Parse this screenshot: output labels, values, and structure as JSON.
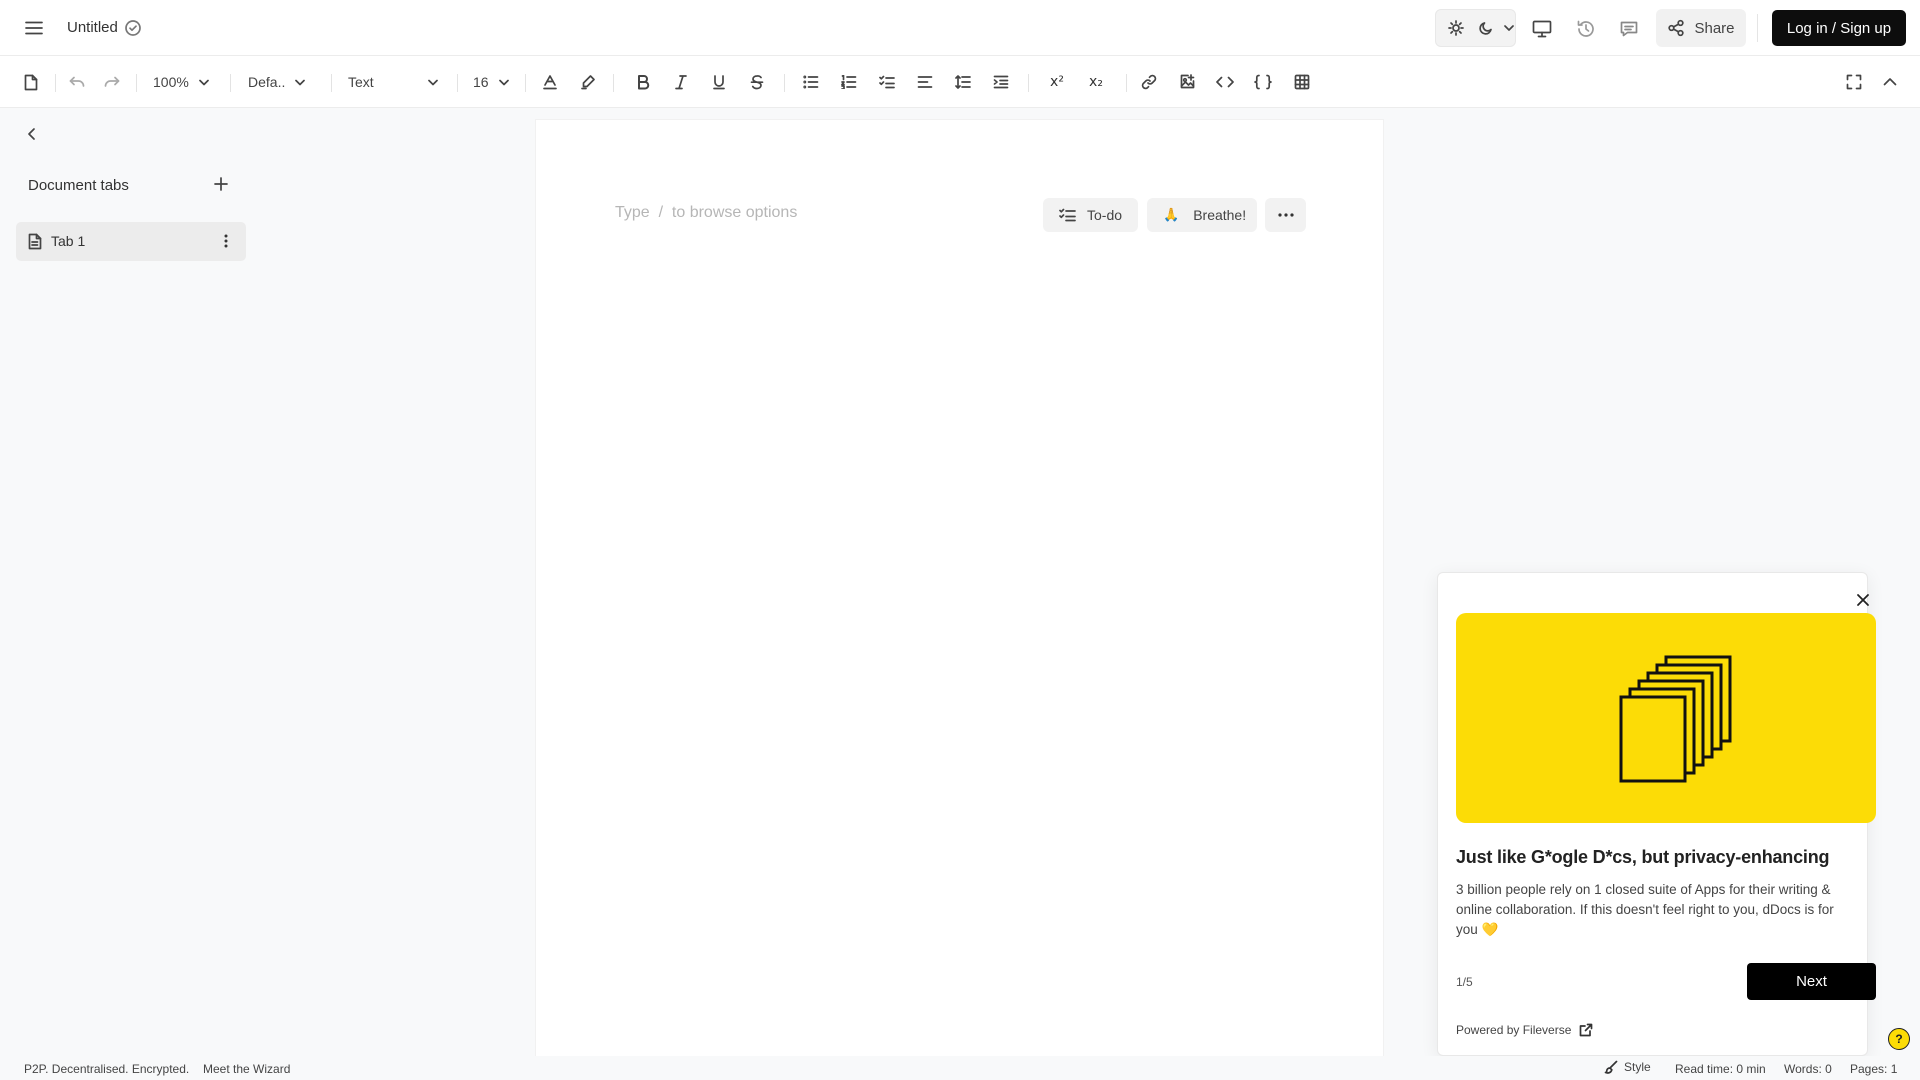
{
  "header": {
    "title": "Untitled",
    "share_label": "Share",
    "login_label": "Log in / Sign up"
  },
  "toolbar": {
    "zoom": "100%",
    "font_family": "Defa..",
    "text_style": "Text",
    "font_size": "16",
    "superscript_glyph": "x²",
    "subscript_glyph": "x₂",
    "icons": [
      "file-icon",
      "undo-icon",
      "redo-icon",
      "text-color-icon",
      "highlighter-icon",
      "bold-icon",
      "italic-icon",
      "underline-icon",
      "strikethrough-icon",
      "bullet-list-icon",
      "numbered-list-icon",
      "checklist-icon",
      "align-left-icon",
      "line-spacing-icon",
      "indent-icon",
      "superscript-icon",
      "subscript-icon",
      "link-icon",
      "image-icon",
      "code-icon",
      "code-block-icon",
      "table-icon",
      "fullscreen-icon",
      "collapse-icon"
    ]
  },
  "sidebar": {
    "heading": "Document tabs",
    "tabs": [
      {
        "label": "Tab 1"
      }
    ]
  },
  "editor": {
    "placeholder": "Type  /  to browse options",
    "quick_actions": [
      {
        "label": "To-do",
        "icon": "checklist-icon"
      },
      {
        "label": "Breathe!",
        "icon": "🙏"
      }
    ]
  },
  "onboarding": {
    "title": "Just like G*ogle D*cs, but privacy-enhancing",
    "body": "3 billion people rely on 1 closed suite of Apps for their writing & online collaboration. If this doesn't feel right to you, dDocs is for you 💛",
    "step": "1/5",
    "next_label": "Next",
    "powered_by": "Powered by Fileverse",
    "hero_color": "#fcdc06"
  },
  "statusbar": {
    "tagline": "P2P. Decentralised. Encrypted.",
    "wizard": "Meet the Wizard",
    "style": "Style",
    "read_time": "Read time: 0 min",
    "words": "Words: 0",
    "pages": "Pages: 1"
  },
  "colors": {
    "accent": "#0d0d0d",
    "brand_yellow": "#fcdc06",
    "background": "#f8f9fa"
  }
}
